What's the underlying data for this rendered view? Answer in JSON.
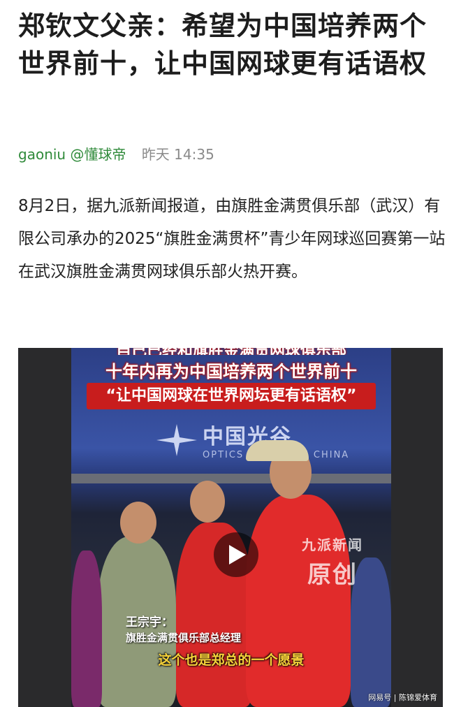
{
  "article": {
    "title": "郑钦文父亲：希望为中国培养两个世界前十，让中国网球更有话语权",
    "author": "gaoniu @懂球帝",
    "time": "昨天 14:35",
    "body": "8月2日，据九派新闻报道，由旗胜金满贯俱乐部（武汉）有限公司承办的2025“旗胜金满贯杯”青少年网球巡回赛第一站在武汉旗胜金满贯网球俱乐部火热开赛。"
  },
  "video": {
    "banner_cut": "自己已经和旗胜金满贯网球俱乐部",
    "caption_line1": "十年内再为中国培养两个世界前十",
    "caption_line2": "“让中国网球在世界网坛更有话语权”",
    "logo_cn": "中国光谷",
    "logo_en": "OPTICS VALLEY OF CHINA",
    "watermark_line1": "九派新闻",
    "watermark_line2": "原创",
    "speaker_name": "王宗宇：",
    "speaker_title": "旗胜金满贯俱乐部总经理",
    "subtitle": "这个也是郑总的一个愿景",
    "source": "网易号 | 陈锦爱体育",
    "play_icon": "play-icon"
  },
  "colors": {
    "author": "#2f8a3a",
    "time": "#8a8a8a",
    "caption_bg": "#c81d1d",
    "subtitle": "#f6d23a"
  }
}
